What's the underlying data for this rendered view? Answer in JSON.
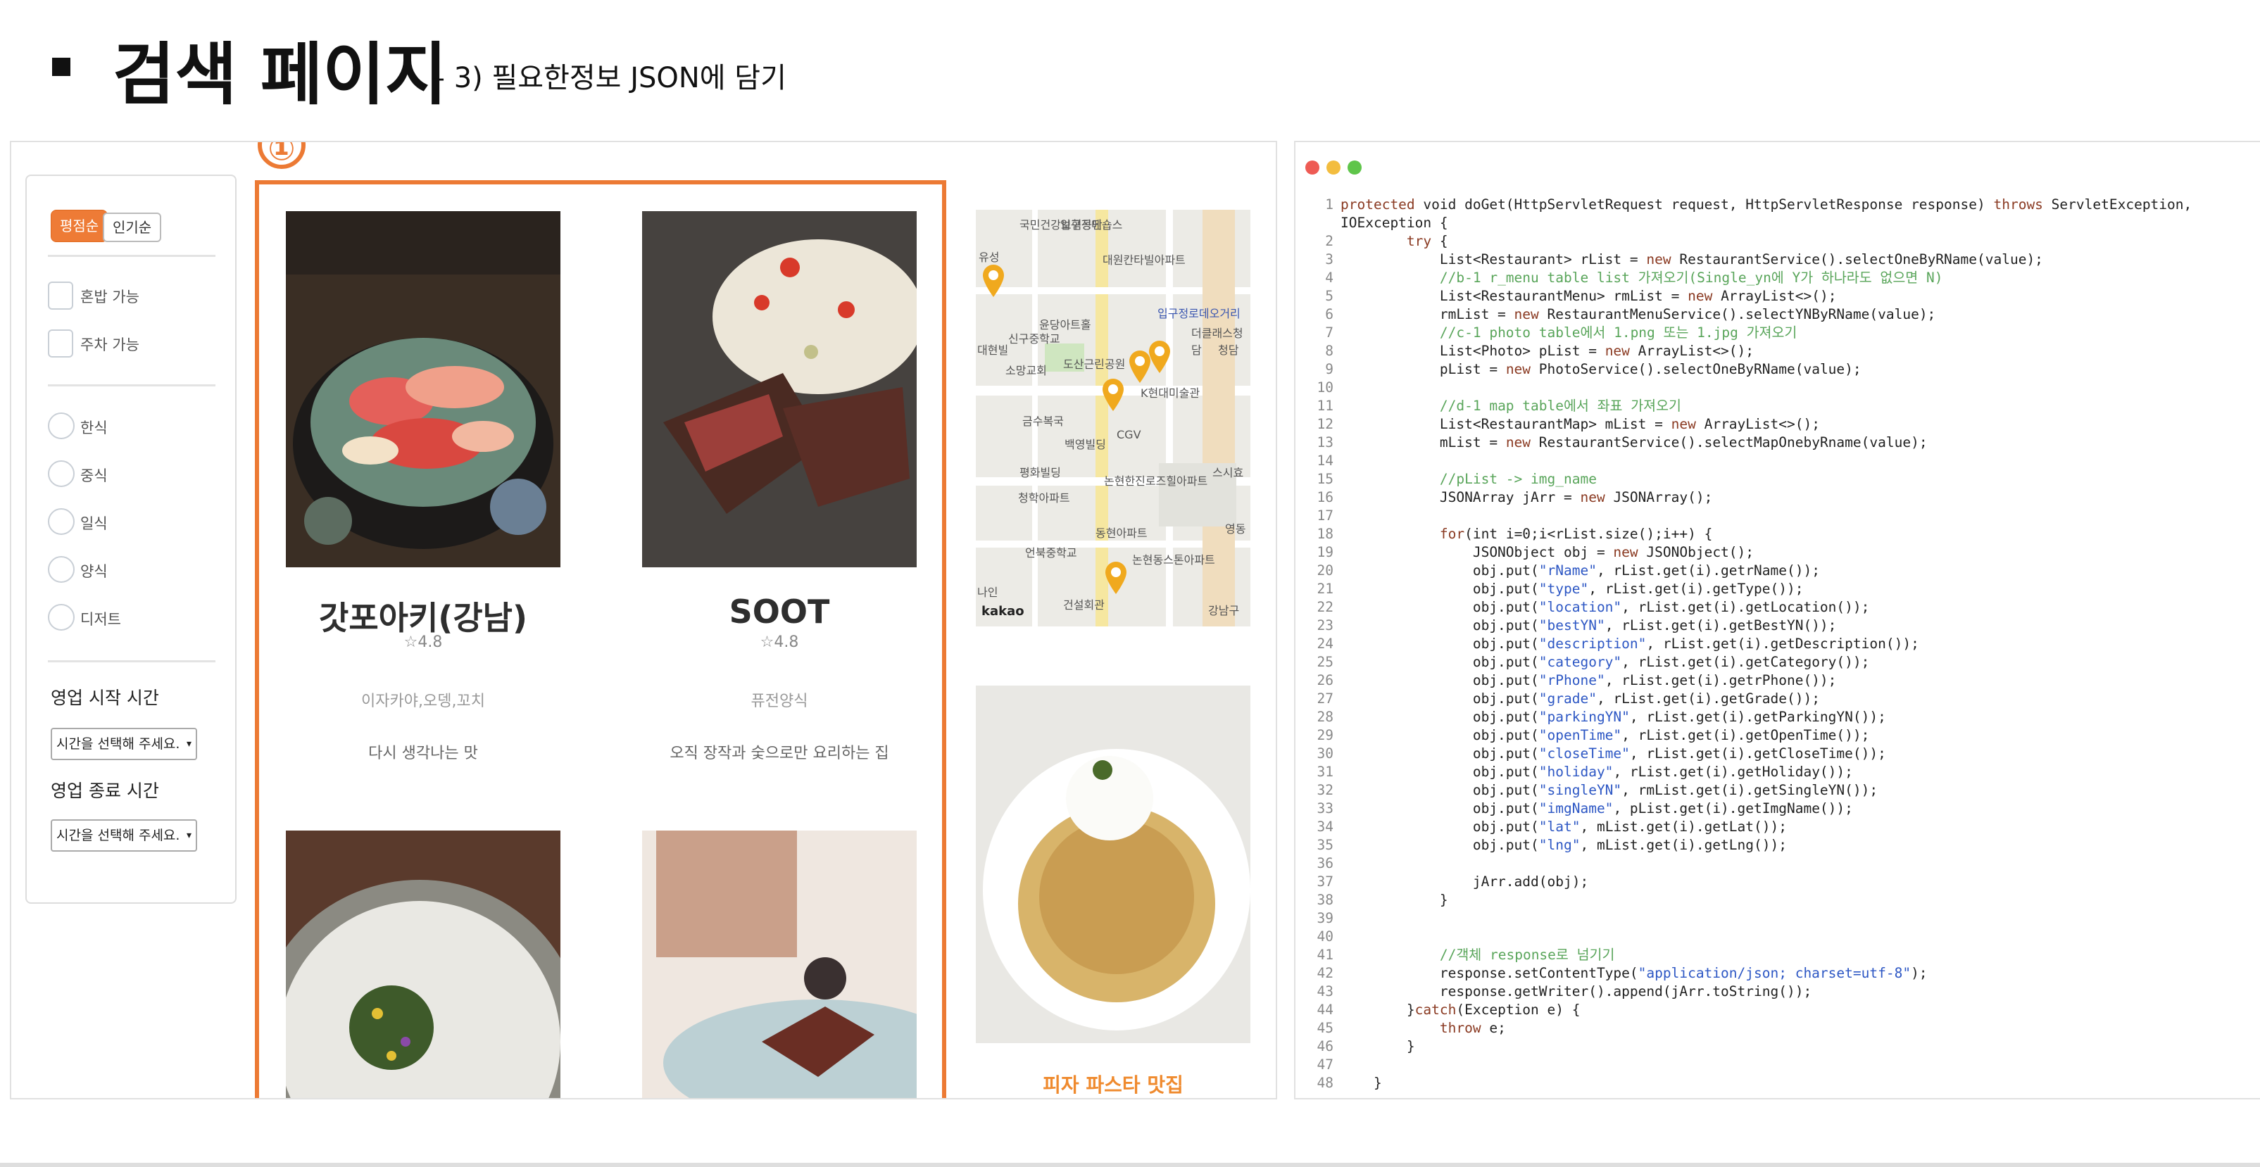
{
  "slide": {
    "title": "검색 페이지",
    "subtitle": "– 3) 필요한정보 JSON에 담기",
    "callout_number": "①"
  },
  "filter": {
    "sort_options": [
      "평점순",
      "인기순"
    ],
    "active_sort": "평점순",
    "checkbox_options": [
      "혼밥 가능",
      "주차 가능"
    ],
    "category_options": [
      "한식",
      "중식",
      "일식",
      "양식",
      "디저트"
    ],
    "open_time_label": "영업 시작 시간",
    "close_time_label": "영업 종료 시간",
    "time_select_placeholder": "시간을 선택해 주세요.",
    "select_arrow": "▾"
  },
  "cards": [
    {
      "name": "갓포아키(강남)",
      "grade": "☆4.8",
      "category": "이자카야,오뎅,꼬치",
      "description": "다시 생각나는 맛",
      "image": "sashimi-platter"
    },
    {
      "name": "SOOT",
      "grade": "☆4.8",
      "category": "퓨전양식",
      "description": "오직 장작과 숯으로만 요리하는 집",
      "image": "grilled-steak"
    },
    {
      "name": "",
      "image": "herb-salad"
    },
    {
      "name": "",
      "image": "braised-meat"
    }
  ],
  "map": {
    "labels": [
      "국민건강보험공단",
      "입구정메숍스",
      "유성",
      "대원칸타빌아파트",
      "신구중학교",
      "입구정로데오거리",
      "더클래스청담",
      "청담",
      "대현빌",
      "윤당아트홀",
      "소망교회",
      "도산근린공원",
      "K현대미술관",
      "금수복국",
      "CGV",
      "백영빌딩",
      "평화빌딩",
      "스시효",
      "논현한진로즈힐아파트",
      "청학아파트",
      "영동",
      "동현아파트",
      "언북중학교",
      "논현동스톤아파트",
      "나인",
      "건설회관",
      "강남구",
      "kakao"
    ],
    "pin_icon": "map-pin-icon"
  },
  "right_column": {
    "caption": "피자 파스타 맛집",
    "image": "pasta-burrata"
  },
  "code": {
    "lines": [
      [
        {
          "t": "protected",
          "c": "kw"
        },
        {
          "t": " void doGet(HttpServletRequest request, HttpServletResponse response) "
        },
        {
          "t": "throws",
          "c": "kw"
        },
        {
          "t": " ServletException,"
        }
      ],
      [
        {
          "t": "IOException {"
        }
      ],
      [
        {
          "t": "        "
        },
        {
          "t": "try",
          "c": "kw"
        },
        {
          "t": " {"
        }
      ],
      [
        {
          "t": "            List<Restaurant> rList = "
        },
        {
          "t": "new",
          "c": "kw"
        },
        {
          "t": " RestaurantService().selectOneByRName(value);"
        }
      ],
      [
        {
          "t": "            "
        },
        {
          "t": "//b-1 r_menu table list 가져오기(Single_yn에 Y가 하나라도 없으면 N)",
          "c": "cm"
        }
      ],
      [
        {
          "t": "            List<RestaurantMenu> rmList = "
        },
        {
          "t": "new",
          "c": "kw"
        },
        {
          "t": " ArrayList<>();"
        }
      ],
      [
        {
          "t": "            rmList = "
        },
        {
          "t": "new",
          "c": "kw"
        },
        {
          "t": " RestaurantMenuService().selectYNByRName(value);"
        }
      ],
      [
        {
          "t": "            "
        },
        {
          "t": "//c-1 photo table에서 1.png 또는 1.jpg 가져오기",
          "c": "cm"
        }
      ],
      [
        {
          "t": "            List<Photo> pList = "
        },
        {
          "t": "new",
          "c": "kw"
        },
        {
          "t": " ArrayList<>();"
        }
      ],
      [
        {
          "t": "            pList = "
        },
        {
          "t": "new",
          "c": "kw"
        },
        {
          "t": " PhotoService().selectOneByRName(value);"
        }
      ],
      [
        {
          "t": ""
        }
      ],
      [
        {
          "t": "            "
        },
        {
          "t": "//d-1 map table에서 좌표 가져오기",
          "c": "cm"
        }
      ],
      [
        {
          "t": "            List<RestaurantMap> mList = "
        },
        {
          "t": "new",
          "c": "kw"
        },
        {
          "t": " ArrayList<>();"
        }
      ],
      [
        {
          "t": "            mList = "
        },
        {
          "t": "new",
          "c": "kw"
        },
        {
          "t": " RestaurantService().selectMapOnebyRname(value);"
        }
      ],
      [
        {
          "t": ""
        }
      ],
      [
        {
          "t": "            "
        },
        {
          "t": "//pList -> img_name",
          "c": "cm"
        }
      ],
      [
        {
          "t": "            JSONArray jArr = "
        },
        {
          "t": "new",
          "c": "kw"
        },
        {
          "t": " JSONArray();"
        }
      ],
      [
        {
          "t": ""
        }
      ],
      [
        {
          "t": "            "
        },
        {
          "t": "for",
          "c": "kw"
        },
        {
          "t": "(int i=0;i<rList.size();i++) {"
        }
      ],
      [
        {
          "t": "                JSONObject obj = "
        },
        {
          "t": "new",
          "c": "kw"
        },
        {
          "t": " JSONObject();"
        }
      ],
      [
        {
          "t": "                obj.put("
        },
        {
          "t": "\"rName\"",
          "c": "str"
        },
        {
          "t": ", rList.get(i).getrName());"
        }
      ],
      [
        {
          "t": "                obj.put("
        },
        {
          "t": "\"type\"",
          "c": "str"
        },
        {
          "t": ", rList.get(i).getType());"
        }
      ],
      [
        {
          "t": "                obj.put("
        },
        {
          "t": "\"location\"",
          "c": "str"
        },
        {
          "t": ", rList.get(i).getLocation());"
        }
      ],
      [
        {
          "t": "                obj.put("
        },
        {
          "t": "\"bestYN\"",
          "c": "str"
        },
        {
          "t": ", rList.get(i).getBestYN());"
        }
      ],
      [
        {
          "t": "                obj.put("
        },
        {
          "t": "\"description\"",
          "c": "str"
        },
        {
          "t": ", rList.get(i).getDescription());"
        }
      ],
      [
        {
          "t": "                obj.put("
        },
        {
          "t": "\"category\"",
          "c": "str"
        },
        {
          "t": ", rList.get(i).getCategory());"
        }
      ],
      [
        {
          "t": "                obj.put("
        },
        {
          "t": "\"rPhone\"",
          "c": "str"
        },
        {
          "t": ", rList.get(i).getrPhone());"
        }
      ],
      [
        {
          "t": "                obj.put("
        },
        {
          "t": "\"grade\"",
          "c": "str"
        },
        {
          "t": ", rList.get(i).getGrade());"
        }
      ],
      [
        {
          "t": "                obj.put("
        },
        {
          "t": "\"parkingYN\"",
          "c": "str"
        },
        {
          "t": ", rList.get(i).getParkingYN());"
        }
      ],
      [
        {
          "t": "                obj.put("
        },
        {
          "t": "\"openTime\"",
          "c": "str"
        },
        {
          "t": ", rList.get(i).getOpenTime());"
        }
      ],
      [
        {
          "t": "                obj.put("
        },
        {
          "t": "\"closeTime\"",
          "c": "str"
        },
        {
          "t": ", rList.get(i).getCloseTime());"
        }
      ],
      [
        {
          "t": "                obj.put("
        },
        {
          "t": "\"holiday\"",
          "c": "str"
        },
        {
          "t": ", rList.get(i).getHoliday());"
        }
      ],
      [
        {
          "t": "                obj.put("
        },
        {
          "t": "\"singleYN\"",
          "c": "str"
        },
        {
          "t": ", rmList.get(i).getSingleYN());"
        }
      ],
      [
        {
          "t": "                obj.put("
        },
        {
          "t": "\"imgName\"",
          "c": "str"
        },
        {
          "t": ", pList.get(i).getImgName());"
        }
      ],
      [
        {
          "t": "                obj.put("
        },
        {
          "t": "\"lat\"",
          "c": "str"
        },
        {
          "t": ", mList.get(i).getLat());"
        }
      ],
      [
        {
          "t": "                obj.put("
        },
        {
          "t": "\"lng\"",
          "c": "str"
        },
        {
          "t": ", mList.get(i).getLng());"
        }
      ],
      [
        {
          "t": ""
        }
      ],
      [
        {
          "t": "                jArr.add(obj);"
        }
      ],
      [
        {
          "t": "            }"
        }
      ],
      [
        {
          "t": ""
        }
      ],
      [
        {
          "t": ""
        }
      ],
      [
        {
          "t": "            "
        },
        {
          "t": "//객체 response로 넘기기",
          "c": "cm"
        }
      ],
      [
        {
          "t": "            response.setContentType("
        },
        {
          "t": "\"application/json; charset=utf-8\"",
          "c": "str"
        },
        {
          "t": ");"
        }
      ],
      [
        {
          "t": "            response.getWriter().append(jArr.toString());"
        }
      ],
      [
        {
          "t": "        }"
        },
        {
          "t": "catch",
          "c": "kw"
        },
        {
          "t": "(Exception e) {"
        }
      ],
      [
        {
          "t": "            "
        },
        {
          "t": "throw",
          "c": "kw"
        },
        {
          "t": " e;"
        }
      ],
      [
        {
          "t": "        }"
        }
      ],
      [
        {
          "t": ""
        }
      ],
      [
        {
          "t": "    }"
        }
      ]
    ],
    "line_numbers": [
      "1",
      "",
      "2",
      "3",
      "4",
      "5",
      "6",
      "7",
      "8",
      "9",
      "10",
      "11",
      "12",
      "13",
      "14",
      "15",
      "16",
      "17",
      "18",
      "19",
      "20",
      "21",
      "22",
      "23",
      "24",
      "25",
      "26",
      "27",
      "28",
      "29",
      "30",
      "31",
      "32",
      "33",
      "34",
      "35",
      "36",
      "37",
      "38",
      "39",
      "40",
      "41",
      "42",
      "43",
      "44",
      "45",
      "46",
      "47",
      "48"
    ]
  },
  "colors": {
    "accent_orange": "#ec7a34",
    "window_red": "#ee5b54",
    "window_yellow": "#f3bd3f",
    "window_green": "#5fc54a"
  }
}
